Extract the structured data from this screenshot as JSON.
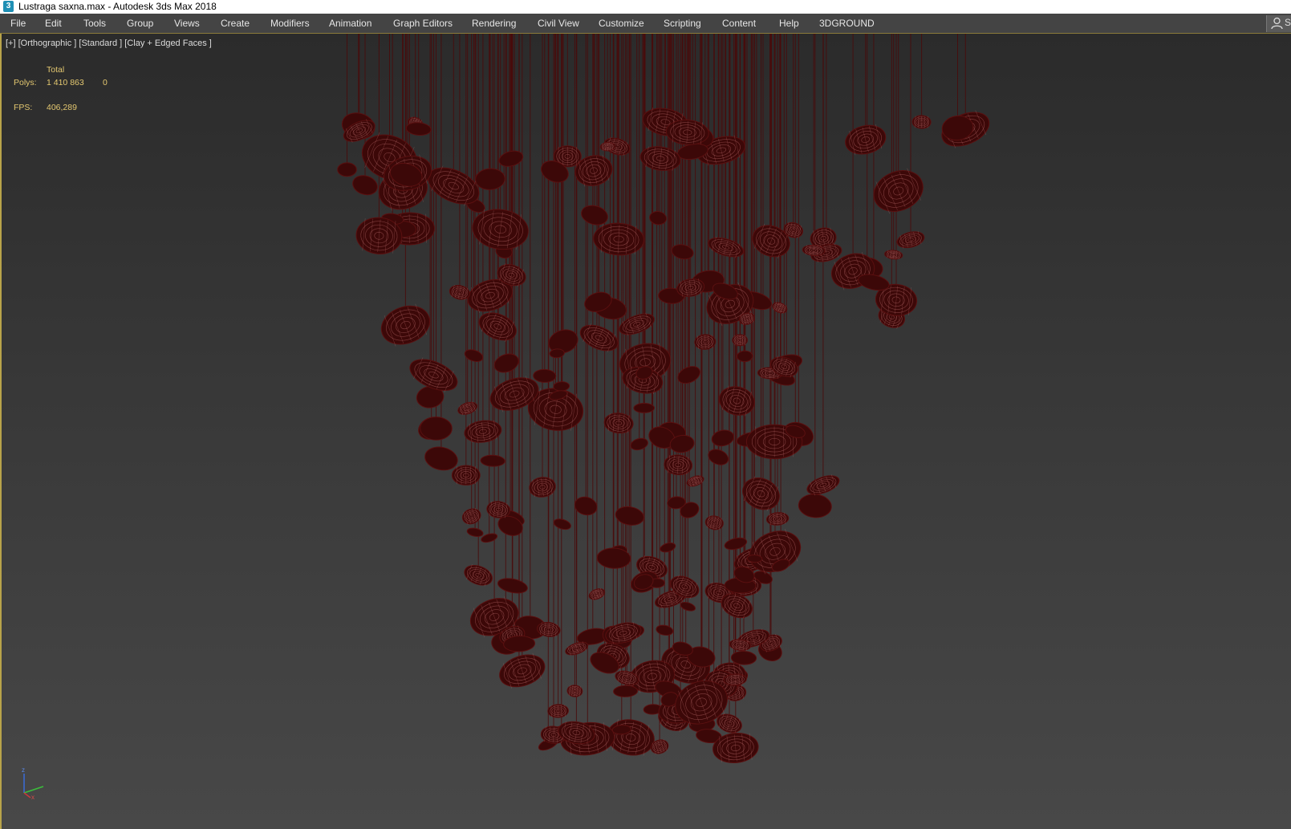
{
  "window": {
    "icon_text": "3",
    "title": "Lustraga saxna.max - Autodesk 3ds Max 2018"
  },
  "menubar": {
    "items": [
      "File",
      "Edit",
      "Tools",
      "Group",
      "Views",
      "Create",
      "Modifiers",
      "Animation",
      "Graph Editors",
      "Rendering",
      "Civil View",
      "Customize",
      "Scripting",
      "Content",
      "Help",
      "3DGROUND"
    ],
    "account_label": "S"
  },
  "viewport": {
    "label": "[+] [Orthographic ] [Standard ] [Clay + Edged Faces ]",
    "stats": {
      "total_label": "Total",
      "polys_label": "Polys:",
      "polys_value": "1 410 863",
      "polys_selected": "0",
      "fps_label": "FPS:",
      "fps_value": "406,289"
    },
    "axis": {
      "z": "z",
      "x": "x"
    }
  },
  "colors": {
    "mesh_fill": "#3c0808",
    "mesh_wire": "#b86a6a",
    "wire_string": "#4a0a0a",
    "stats_text": "#e4c870",
    "viewport_border": "#b8a34a"
  }
}
